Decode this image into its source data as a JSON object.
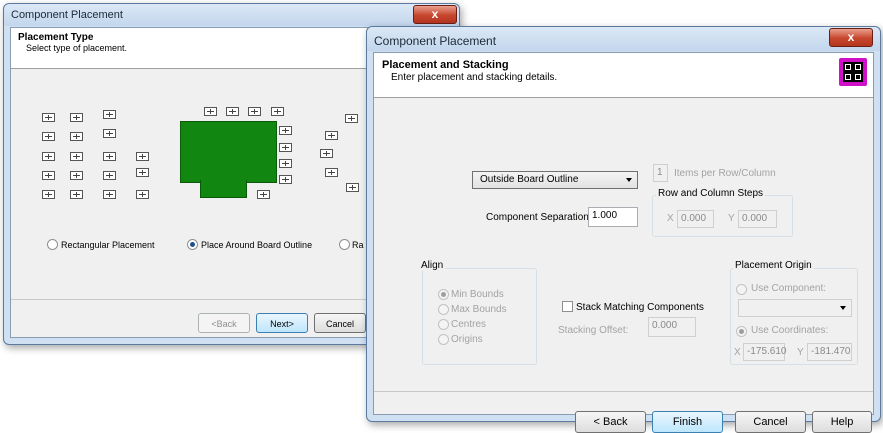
{
  "window1": {
    "title": "Component Placement",
    "close": "x",
    "header_title": "Placement Type",
    "header_subtitle": "Select type of placement.",
    "options": {
      "rectangular": "Rectangular Placement",
      "around_outline": "Place Around Board Outline",
      "radial_partial": "Ra"
    },
    "buttons": {
      "back": "<Back",
      "next": "Next>",
      "cancel": "Cancel"
    }
  },
  "window2": {
    "title": "Component Placement",
    "close": "x",
    "header_title": "Placement and Stacking",
    "header_subtitle": "Enter placement and stacking details.",
    "placement_dropdown": "Outside Board Outline",
    "items_per_row_value": "1",
    "items_per_row_label": "Items per Row/Column",
    "row_col_steps_label": "Row and Column Steps",
    "x_label": "X",
    "x_step": "0.000",
    "y_label": "Y",
    "y_step": "0.000",
    "separation_label": "Component Separation:",
    "separation_value": "1.000",
    "align": {
      "title": "Align",
      "options": [
        "Min Bounds",
        "Max Bounds",
        "Centres",
        "Origins"
      ]
    },
    "stack_label": "Stack Matching Components",
    "stacking_offset_label": "Stacking Offset:",
    "stacking_offset_value": "0.000",
    "origin": {
      "title": "Placement Origin",
      "use_component": "Use Component:",
      "use_coordinates": "Use Coordinates:",
      "x_label": "X",
      "x_value": "-175.610",
      "y_label": "Y",
      "y_value": "-181.470"
    },
    "buttons": {
      "back": "< Back",
      "finish": "Finish",
      "cancel": "Cancel",
      "help": "Help"
    }
  }
}
